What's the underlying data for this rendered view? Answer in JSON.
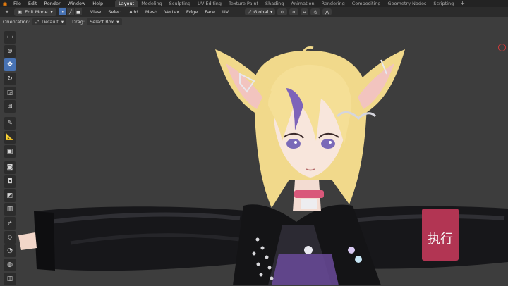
{
  "top_menu": [
    "File",
    "Edit",
    "Render",
    "Window",
    "Help"
  ],
  "workspace_tabs": [
    {
      "label": "Layout",
      "active": true
    },
    {
      "label": "Modeling"
    },
    {
      "label": "Sculpting"
    },
    {
      "label": "UV Editing"
    },
    {
      "label": "Texture Paint"
    },
    {
      "label": "Shading"
    },
    {
      "label": "Animation"
    },
    {
      "label": "Rendering"
    },
    {
      "label": "Compositing"
    },
    {
      "label": "Geometry Nodes"
    },
    {
      "label": "Scripting"
    }
  ],
  "workspace_add": "+",
  "header": {
    "mode": "Edit Mode",
    "menus": [
      "View",
      "Select",
      "Add",
      "Mesh",
      "Vertex",
      "Edge",
      "Face",
      "UV"
    ],
    "transform_orientation": "Global"
  },
  "tool_options": {
    "orientation_label": "Orientation:",
    "orientation_value": "Default",
    "drag_label": "Drag:",
    "drag_value": "Select Box"
  },
  "toolbar_icons": [
    "select-box-icon",
    "cursor-icon",
    "move-icon",
    "rotate-icon",
    "scale-icon",
    "transform-icon",
    "annotate-icon",
    "measure-icon",
    "add-cube-icon",
    "extrude-icon",
    "inset-icon",
    "bevel-icon",
    "loop-cut-icon",
    "knife-icon",
    "poly-build-icon",
    "spin-icon",
    "smooth-icon",
    "shrink-fatten-icon",
    "shear-icon",
    "rip-icon"
  ],
  "armband_text": "执行",
  "colors": {
    "accent": "#4772b3",
    "viewport": "#3d3d3d",
    "hair": "#f1d98b",
    "jacket": "#151517",
    "armband": "#b23553"
  }
}
